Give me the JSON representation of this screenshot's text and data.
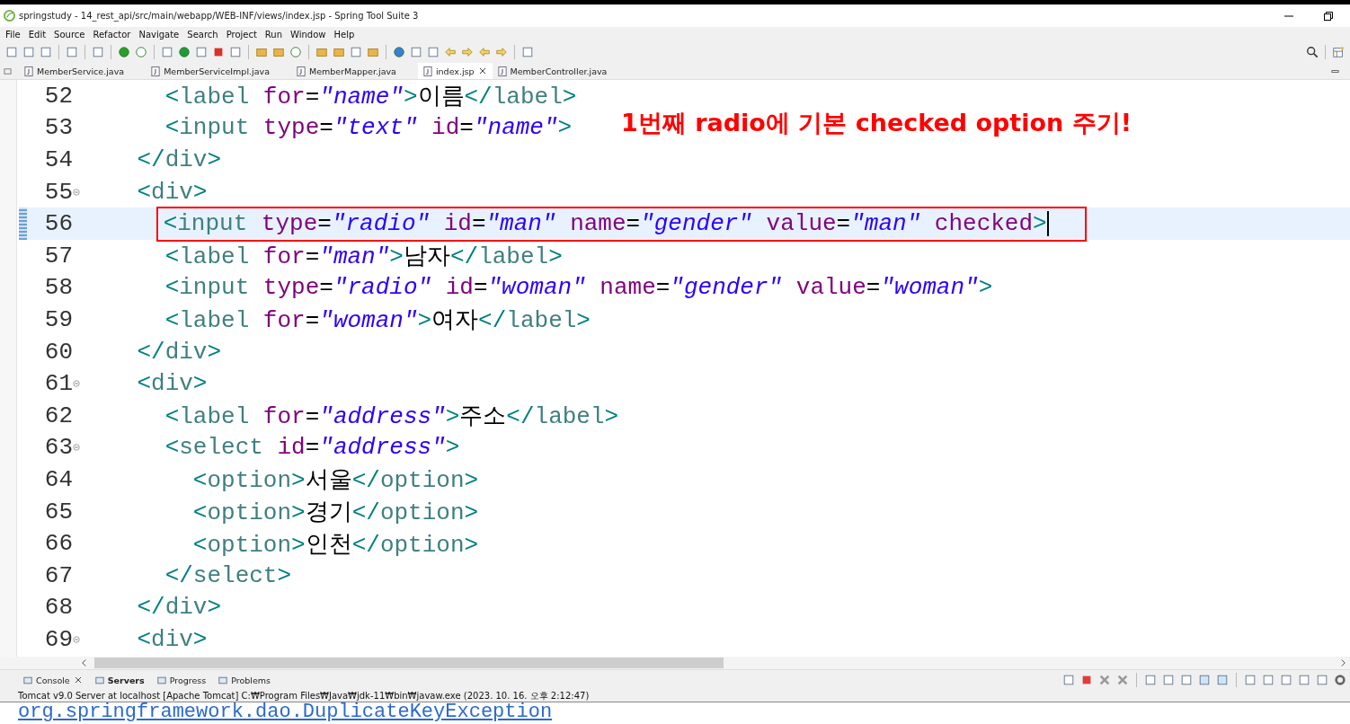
{
  "window": {
    "title": "springstudy - 14_rest_api/src/main/webapp/WEB-INF/views/index.jsp - Spring Tool Suite 3"
  },
  "menu": [
    "File",
    "Edit",
    "Source",
    "Refactor",
    "Navigate",
    "Search",
    "Project",
    "Run",
    "Window",
    "Help"
  ],
  "tabs": [
    {
      "label": "MemberService.java",
      "selected": false
    },
    {
      "label": "MemberServiceImpl.java",
      "selected": false
    },
    {
      "label": "MemberMapper.java",
      "selected": false
    },
    {
      "label": "index.jsp",
      "selected": true
    },
    {
      "label": "MemberController.java",
      "selected": false
    }
  ],
  "editor": {
    "lines": [
      {
        "number": "52",
        "fold": false,
        "highlighted": false,
        "segments": [
          {
            "kind": "bracket",
            "t": "      <"
          },
          {
            "kind": "tag",
            "t": "label"
          },
          {
            "kind": "attr",
            "t": " for"
          },
          {
            "kind": "plain",
            "t": "="
          },
          {
            "kind": "value",
            "t": "\"name\""
          },
          {
            "kind": "bracket",
            "t": ">"
          },
          {
            "kind": "text",
            "t": "이름"
          },
          {
            "kind": "bracket",
            "t": "</"
          },
          {
            "kind": "tag",
            "t": "label"
          },
          {
            "kind": "bracket",
            "t": ">"
          }
        ]
      },
      {
        "number": "53",
        "fold": false,
        "highlighted": false,
        "segments": [
          {
            "kind": "bracket",
            "t": "      <"
          },
          {
            "kind": "tag",
            "t": "input"
          },
          {
            "kind": "attr",
            "t": " type"
          },
          {
            "kind": "plain",
            "t": "="
          },
          {
            "kind": "value",
            "t": "\"text\""
          },
          {
            "kind": "attr",
            "t": " id"
          },
          {
            "kind": "plain",
            "t": "="
          },
          {
            "kind": "value",
            "t": "\"name\""
          },
          {
            "kind": "bracket",
            "t": ">"
          }
        ]
      },
      {
        "number": "54",
        "fold": false,
        "highlighted": false,
        "segments": [
          {
            "kind": "bracket",
            "t": "    </"
          },
          {
            "kind": "tag",
            "t": "div"
          },
          {
            "kind": "bracket",
            "t": ">"
          }
        ]
      },
      {
        "number": "55",
        "fold": true,
        "highlighted": false,
        "segments": [
          {
            "kind": "bracket",
            "t": "    <"
          },
          {
            "kind": "tag",
            "t": "div"
          },
          {
            "kind": "bracket",
            "t": ">"
          }
        ]
      },
      {
        "number": "56",
        "fold": false,
        "highlighted": true,
        "segments": [
          {
            "kind": "bracket",
            "t": "      <"
          },
          {
            "kind": "tag",
            "t": "input"
          },
          {
            "kind": "attr",
            "t": " type"
          },
          {
            "kind": "plain",
            "t": "="
          },
          {
            "kind": "value",
            "t": "\"radio\""
          },
          {
            "kind": "attr",
            "t": " id"
          },
          {
            "kind": "plain",
            "t": "="
          },
          {
            "kind": "value",
            "t": "\"man\""
          },
          {
            "kind": "attr",
            "t": " name"
          },
          {
            "kind": "plain",
            "t": "="
          },
          {
            "kind": "value",
            "t": "\"gender\""
          },
          {
            "kind": "attr",
            "t": " value"
          },
          {
            "kind": "plain",
            "t": "="
          },
          {
            "kind": "value",
            "t": "\"man\""
          },
          {
            "kind": "attr",
            "t": " checked"
          },
          {
            "kind": "bracket",
            "t": ">"
          }
        ]
      },
      {
        "number": "57",
        "fold": false,
        "highlighted": false,
        "segments": [
          {
            "kind": "bracket",
            "t": "      <"
          },
          {
            "kind": "tag",
            "t": "label"
          },
          {
            "kind": "attr",
            "t": " for"
          },
          {
            "kind": "plain",
            "t": "="
          },
          {
            "kind": "value",
            "t": "\"man\""
          },
          {
            "kind": "bracket",
            "t": ">"
          },
          {
            "kind": "text",
            "t": "남자"
          },
          {
            "kind": "bracket",
            "t": "</"
          },
          {
            "kind": "tag",
            "t": "label"
          },
          {
            "kind": "bracket",
            "t": ">"
          }
        ]
      },
      {
        "number": "58",
        "fold": false,
        "highlighted": false,
        "segments": [
          {
            "kind": "bracket",
            "t": "      <"
          },
          {
            "kind": "tag",
            "t": "input"
          },
          {
            "kind": "attr",
            "t": " type"
          },
          {
            "kind": "plain",
            "t": "="
          },
          {
            "kind": "value",
            "t": "\"radio\""
          },
          {
            "kind": "attr",
            "t": " id"
          },
          {
            "kind": "plain",
            "t": "="
          },
          {
            "kind": "value",
            "t": "\"woman\""
          },
          {
            "kind": "attr",
            "t": " name"
          },
          {
            "kind": "plain",
            "t": "="
          },
          {
            "kind": "value",
            "t": "\"gender\""
          },
          {
            "kind": "attr",
            "t": " value"
          },
          {
            "kind": "plain",
            "t": "="
          },
          {
            "kind": "value",
            "t": "\"woman\""
          },
          {
            "kind": "bracket",
            "t": ">"
          }
        ]
      },
      {
        "number": "59",
        "fold": false,
        "highlighted": false,
        "segments": [
          {
            "kind": "bracket",
            "t": "      <"
          },
          {
            "kind": "tag",
            "t": "label"
          },
          {
            "kind": "attr",
            "t": " for"
          },
          {
            "kind": "plain",
            "t": "="
          },
          {
            "kind": "value",
            "t": "\"woman\""
          },
          {
            "kind": "bracket",
            "t": ">"
          },
          {
            "kind": "text",
            "t": "여자"
          },
          {
            "kind": "bracket",
            "t": "</"
          },
          {
            "kind": "tag",
            "t": "label"
          },
          {
            "kind": "bracket",
            "t": ">"
          }
        ]
      },
      {
        "number": "60",
        "fold": false,
        "highlighted": false,
        "segments": [
          {
            "kind": "bracket",
            "t": "    </"
          },
          {
            "kind": "tag",
            "t": "div"
          },
          {
            "kind": "bracket",
            "t": ">"
          }
        ]
      },
      {
        "number": "61",
        "fold": true,
        "highlighted": false,
        "segments": [
          {
            "kind": "bracket",
            "t": "    <"
          },
          {
            "kind": "tag",
            "t": "div"
          },
          {
            "kind": "bracket",
            "t": ">"
          }
        ]
      },
      {
        "number": "62",
        "fold": false,
        "highlighted": false,
        "segments": [
          {
            "kind": "bracket",
            "t": "      <"
          },
          {
            "kind": "tag",
            "t": "label"
          },
          {
            "kind": "attr",
            "t": " for"
          },
          {
            "kind": "plain",
            "t": "="
          },
          {
            "kind": "value",
            "t": "\"address\""
          },
          {
            "kind": "bracket",
            "t": ">"
          },
          {
            "kind": "text",
            "t": "주소"
          },
          {
            "kind": "bracket",
            "t": "</"
          },
          {
            "kind": "tag",
            "t": "label"
          },
          {
            "kind": "bracket",
            "t": ">"
          }
        ]
      },
      {
        "number": "63",
        "fold": true,
        "highlighted": false,
        "segments": [
          {
            "kind": "bracket",
            "t": "      <"
          },
          {
            "kind": "tag",
            "t": "select"
          },
          {
            "kind": "attr",
            "t": " id"
          },
          {
            "kind": "plain",
            "t": "="
          },
          {
            "kind": "value",
            "t": "\"address\""
          },
          {
            "kind": "bracket",
            "t": ">"
          }
        ]
      },
      {
        "number": "64",
        "fold": false,
        "highlighted": false,
        "segments": [
          {
            "kind": "bracket",
            "t": "        <"
          },
          {
            "kind": "tag",
            "t": "option"
          },
          {
            "kind": "bracket",
            "t": ">"
          },
          {
            "kind": "text",
            "t": "서울"
          },
          {
            "kind": "bracket",
            "t": "</"
          },
          {
            "kind": "tag",
            "t": "option"
          },
          {
            "kind": "bracket",
            "t": ">"
          }
        ]
      },
      {
        "number": "65",
        "fold": false,
        "highlighted": false,
        "segments": [
          {
            "kind": "bracket",
            "t": "        <"
          },
          {
            "kind": "tag",
            "t": "option"
          },
          {
            "kind": "bracket",
            "t": ">"
          },
          {
            "kind": "text",
            "t": "경기"
          },
          {
            "kind": "bracket",
            "t": "</"
          },
          {
            "kind": "tag",
            "t": "option"
          },
          {
            "kind": "bracket",
            "t": ">"
          }
        ]
      },
      {
        "number": "66",
        "fold": false,
        "highlighted": false,
        "segments": [
          {
            "kind": "bracket",
            "t": "        <"
          },
          {
            "kind": "tag",
            "t": "option"
          },
          {
            "kind": "bracket",
            "t": ">"
          },
          {
            "kind": "text",
            "t": "인천"
          },
          {
            "kind": "bracket",
            "t": "</"
          },
          {
            "kind": "tag",
            "t": "option"
          },
          {
            "kind": "bracket",
            "t": ">"
          }
        ]
      },
      {
        "number": "67",
        "fold": false,
        "highlighted": false,
        "segments": [
          {
            "kind": "bracket",
            "t": "      </"
          },
          {
            "kind": "tag",
            "t": "select"
          },
          {
            "kind": "bracket",
            "t": ">"
          }
        ]
      },
      {
        "number": "68",
        "fold": false,
        "highlighted": false,
        "segments": [
          {
            "kind": "bracket",
            "t": "    </"
          },
          {
            "kind": "tag",
            "t": "div"
          },
          {
            "kind": "bracket",
            "t": ">"
          }
        ]
      },
      {
        "number": "69",
        "fold": true,
        "highlighted": false,
        "segments": [
          {
            "kind": "bracket",
            "t": "    <"
          },
          {
            "kind": "tag",
            "t": "div"
          },
          {
            "kind": "bracket",
            "t": ">"
          }
        ]
      }
    ],
    "annotation": "1번째 radio에 기본 checked option 주기!"
  },
  "panel": {
    "tabs": [
      {
        "label": "Console",
        "selected": true,
        "bold": false
      },
      {
        "label": "Servers",
        "selected": false,
        "bold": true
      },
      {
        "label": "Progress",
        "selected": false,
        "bold": false
      },
      {
        "label": "Problems",
        "selected": false,
        "bold": false
      }
    ],
    "status": "Tomcat v9.0 Server at localhost [Apache Tomcat] C:₩Program Files₩Java₩jdk-11₩bin₩javaw.exe  (2023. 10. 16. 오후 2:12:47)",
    "output": "org.springframework.dao.DuplicateKeyException"
  }
}
